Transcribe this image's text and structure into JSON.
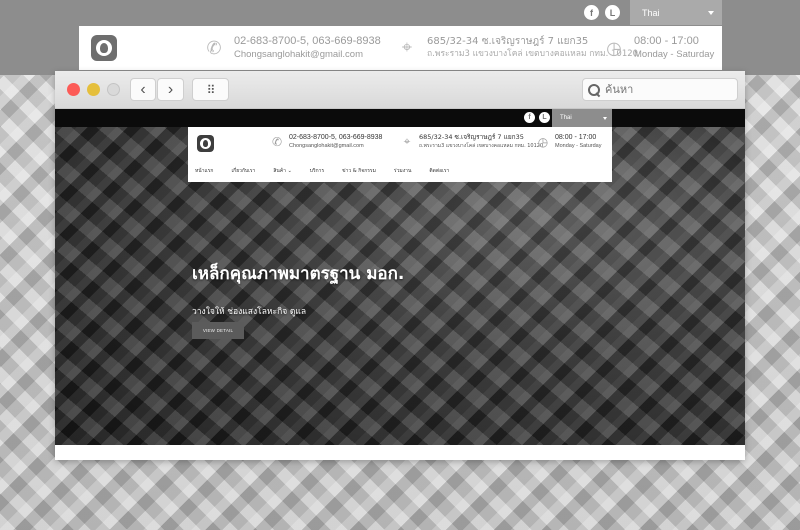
{
  "outer": {
    "social": {
      "facebook": "f",
      "line": "L"
    },
    "language": "Thai",
    "contact": {
      "phone": "02-683-8700-5, 063-669-8938",
      "email": "Chongsanglohakit@gmail.com",
      "address_line1": "685/32-34 ซ.เจริญราษฎร์ 7 แยก35",
      "address_line2": "ถ.พระราม3 แขวงบางโคล่ เขตบางคอแหลม กทม. 10120",
      "hours": "08:00 - 17:00",
      "days": "Monday - Saturday"
    }
  },
  "browser": {
    "search_placeholder": "ค้นหา",
    "back_icon": "‹",
    "forward_icon": "›",
    "colors": {
      "close": "#fc5b57",
      "minimize": "#e5bf3c",
      "zoom": "#d9d9d9"
    }
  },
  "inner": {
    "language": "Thai",
    "contact": {
      "phone": "02-683-8700-5, 063-669-8938",
      "email": "Chongsanglohakit@gmail.com",
      "address_line1": "685/32-34 ซ.เจริญราษฎร์ 7 แยก35",
      "address_line2": "ถ.พระราม3 แขวงบางโคล่ เขตบางคอแหลม กทม. 10120",
      "hours": "08:00 - 17:00",
      "days": "Monday - Saturday"
    },
    "menu": [
      "หน้าแรก",
      "เกี่ยวกับเรา",
      "สินค้า ⌄",
      "บริการ",
      "ข่าว & กิจกรรม",
      "ร่วมงาน",
      "ติดต่อเรา"
    ],
    "hero": {
      "title": "เหล็กคุณภาพมาตรฐาน มอก.",
      "subtitle": "วางใจให้ ช่องแสงโลหะกิจ ดูแล",
      "button": "VIEW DETAIL"
    }
  }
}
